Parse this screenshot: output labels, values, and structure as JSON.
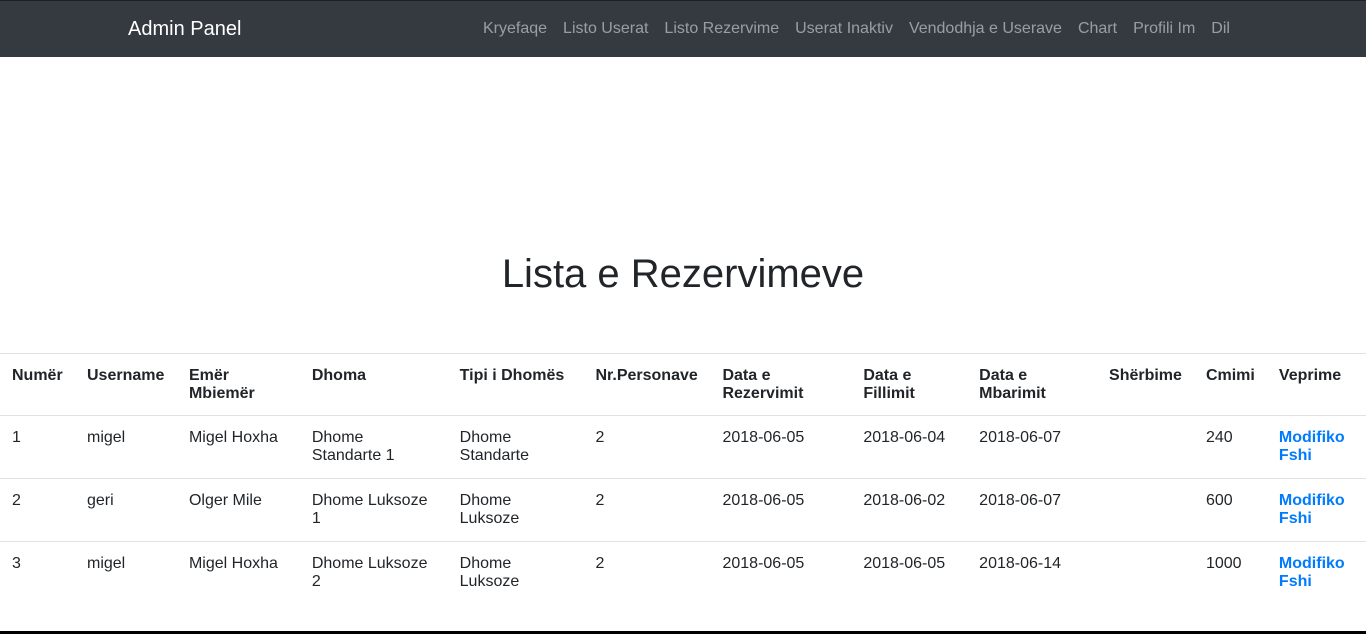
{
  "navbar": {
    "brand": "Admin Panel",
    "links": [
      "Kryefaqe",
      "Listo Userat",
      "Listo Rezervime",
      "Userat Inaktiv",
      "Vendodhja e Userave",
      "Chart",
      "Profili Im",
      "Dil"
    ]
  },
  "page": {
    "title": "Lista e Rezervimeve"
  },
  "table": {
    "headers": [
      "Numër",
      "Username",
      "Emër Mbiemër",
      "Dhoma",
      "Tipi i Dhomës",
      "Nr.Personave",
      "Data e Rezervimit",
      "Data e Fillimit",
      "Data e Mbarimit",
      "Shërbime",
      "Cmimi",
      "Veprime"
    ],
    "rows": [
      {
        "numer": "1",
        "username": "migel",
        "emer": "Migel Hoxha",
        "dhoma": "Dhome Standarte 1",
        "tipi": "Dhome Standarte",
        "personave": "2",
        "rezervimit": "2018-06-05",
        "fillimit": "2018-06-04",
        "mbarimit": "2018-06-07",
        "sherbime": "",
        "cmimi": "240",
        "modifiko": "Modifiko",
        "fshi": "Fshi"
      },
      {
        "numer": "2",
        "username": "geri",
        "emer": "Olger Mile",
        "dhoma": "Dhome Luksoze 1",
        "tipi": "Dhome Luksoze",
        "personave": "2",
        "rezervimit": "2018-06-05",
        "fillimit": "2018-06-02",
        "mbarimit": "2018-06-07",
        "sherbime": "",
        "cmimi": "600",
        "modifiko": "Modifiko",
        "fshi": "Fshi"
      },
      {
        "numer": "3",
        "username": "migel",
        "emer": "Migel Hoxha",
        "dhoma": "Dhome Luksoze 2",
        "tipi": "Dhome Luksoze",
        "personave": "2",
        "rezervimit": "2018-06-05",
        "fillimit": "2018-06-05",
        "mbarimit": "2018-06-14",
        "sherbime": "",
        "cmimi": "1000",
        "modifiko": "Modifiko",
        "fshi": "Fshi"
      }
    ]
  },
  "colors": {
    "navbar_bg": "#343a40",
    "nav_link": "rgba(255,255,255,0.5)",
    "action_link": "#007bff"
  }
}
